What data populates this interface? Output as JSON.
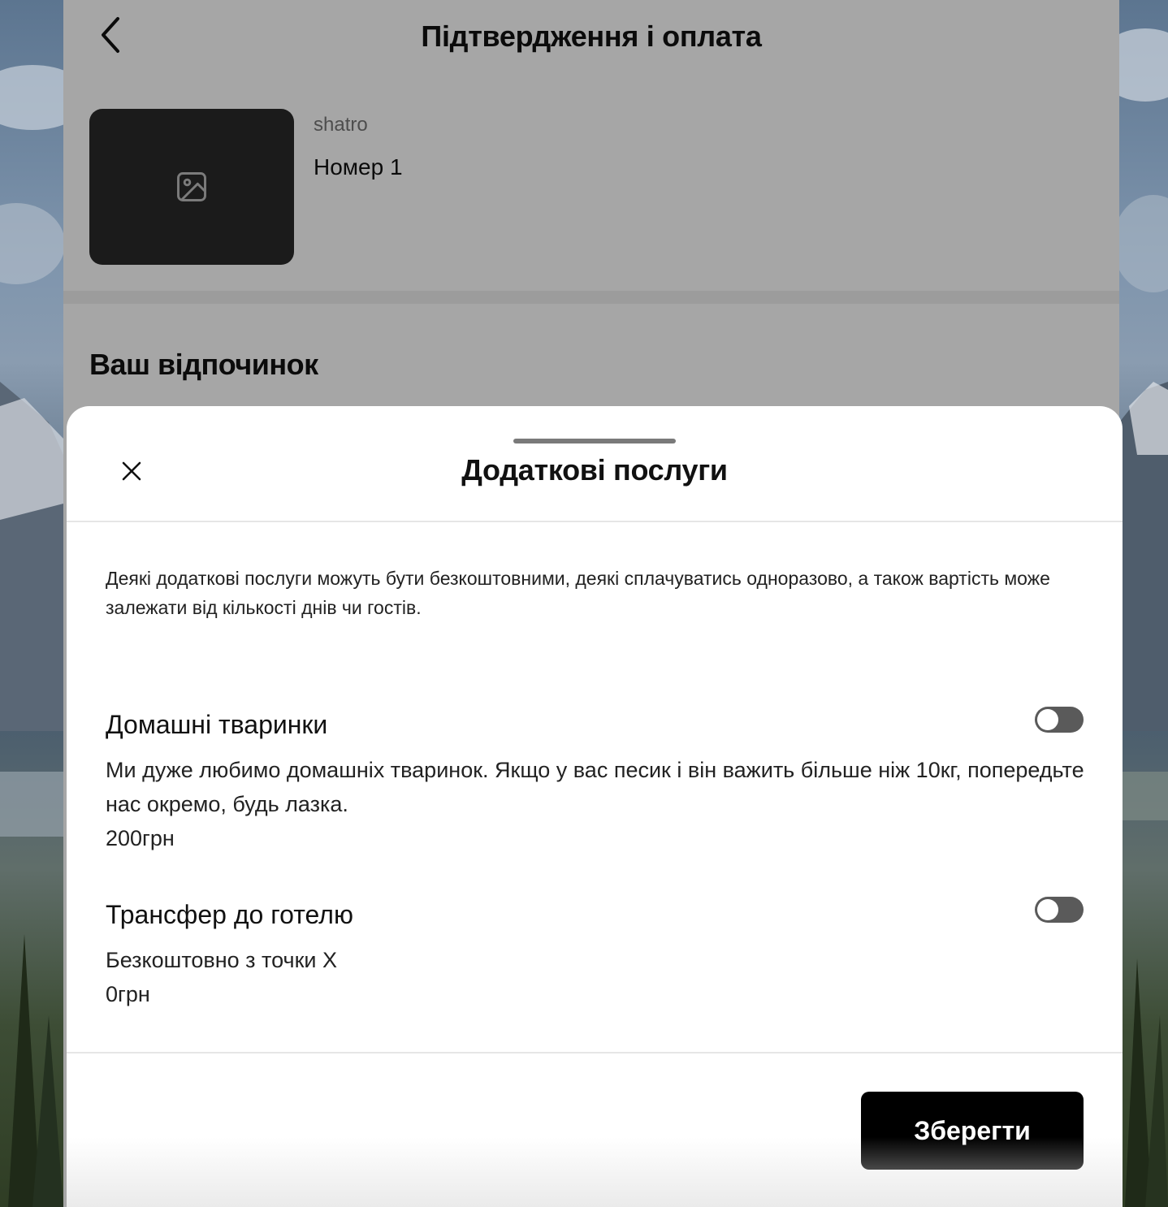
{
  "header": {
    "title": "Підтвердження і оплата"
  },
  "product": {
    "brand": "shatro",
    "name": "Номер 1"
  },
  "section": {
    "title": "Ваш відпочинок"
  },
  "sheet": {
    "title": "Додаткові послуги",
    "intro": "Деякі додаткові послуги можуть бути безкоштовними, деякі сплачуватись одноразово, а також вартість може залежати від кількості днів чи гостів.",
    "services": [
      {
        "name": "Домашні тваринки",
        "description": "Ми дуже любимо домашніх тваринок. Якщо у вас песик і він важить більше ніж 10кг, попередьте нас окремо, будь лазка.",
        "price": "200грн",
        "enabled": false
      },
      {
        "name": "Трансфер до готелю",
        "description": "Безкоштовно з точки X",
        "price": "0грн",
        "enabled": false
      }
    ],
    "save_label": "Зберегти"
  },
  "icons": {
    "back": "chevron-left-icon",
    "image_placeholder": "image-icon",
    "close": "close-icon"
  },
  "colors": {
    "button": "#000000",
    "toggle_off": "#5a5a5a"
  }
}
